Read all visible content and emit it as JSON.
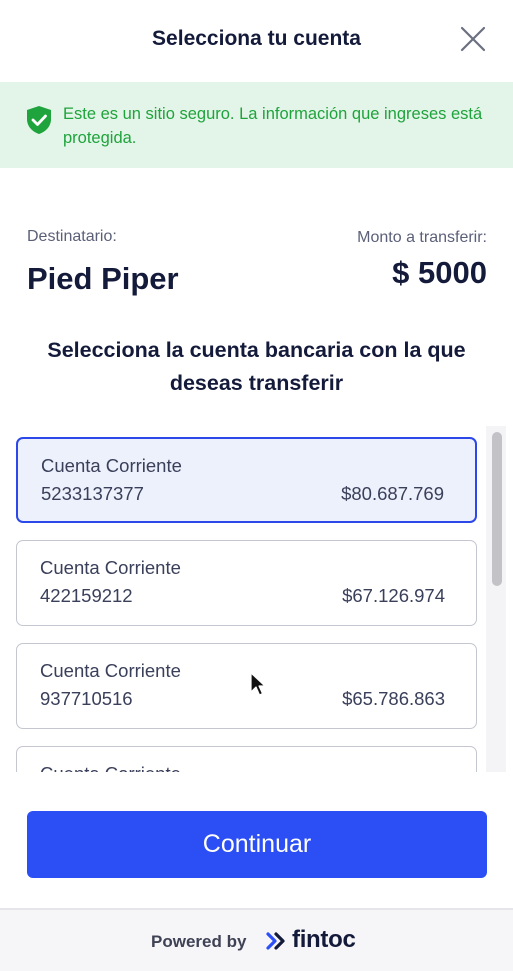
{
  "header": {
    "title": "Selecciona tu cuenta",
    "close_icon": "close-icon"
  },
  "banner": {
    "icon": "shield-check-icon",
    "text": "Este es un sitio seguro. La información que ingreses está protegida.",
    "color": "#1fa33c",
    "background": "#e3f5e8"
  },
  "transfer": {
    "recipient_label": "Destinatario:",
    "recipient_name": "Pied Piper",
    "amount_label": "Monto a transferir:",
    "amount_value": "$ 5000"
  },
  "section_title": "Selecciona la cuenta bancaria con la que deseas transferir",
  "accounts": [
    {
      "type": "Cuenta Corriente",
      "number": "5233137377",
      "balance": "$80.687.769",
      "selected": true
    },
    {
      "type": "Cuenta Corriente",
      "number": "422159212",
      "balance": "$67.126.974",
      "selected": false
    },
    {
      "type": "Cuenta Corriente",
      "number": "937710516",
      "balance": "$65.786.863",
      "selected": false
    },
    {
      "type": "Cuenta Corriente",
      "number": "",
      "balance": "",
      "selected": false
    }
  ],
  "continue_label": "Continuar",
  "footer": {
    "powered_by": "Powered by",
    "brand": "fintoc"
  },
  "colors": {
    "accent": "#2b4ef5",
    "selected_border": "#2c48e8",
    "selected_bg": "#edf1fc",
    "text_dark": "#141a3a"
  }
}
